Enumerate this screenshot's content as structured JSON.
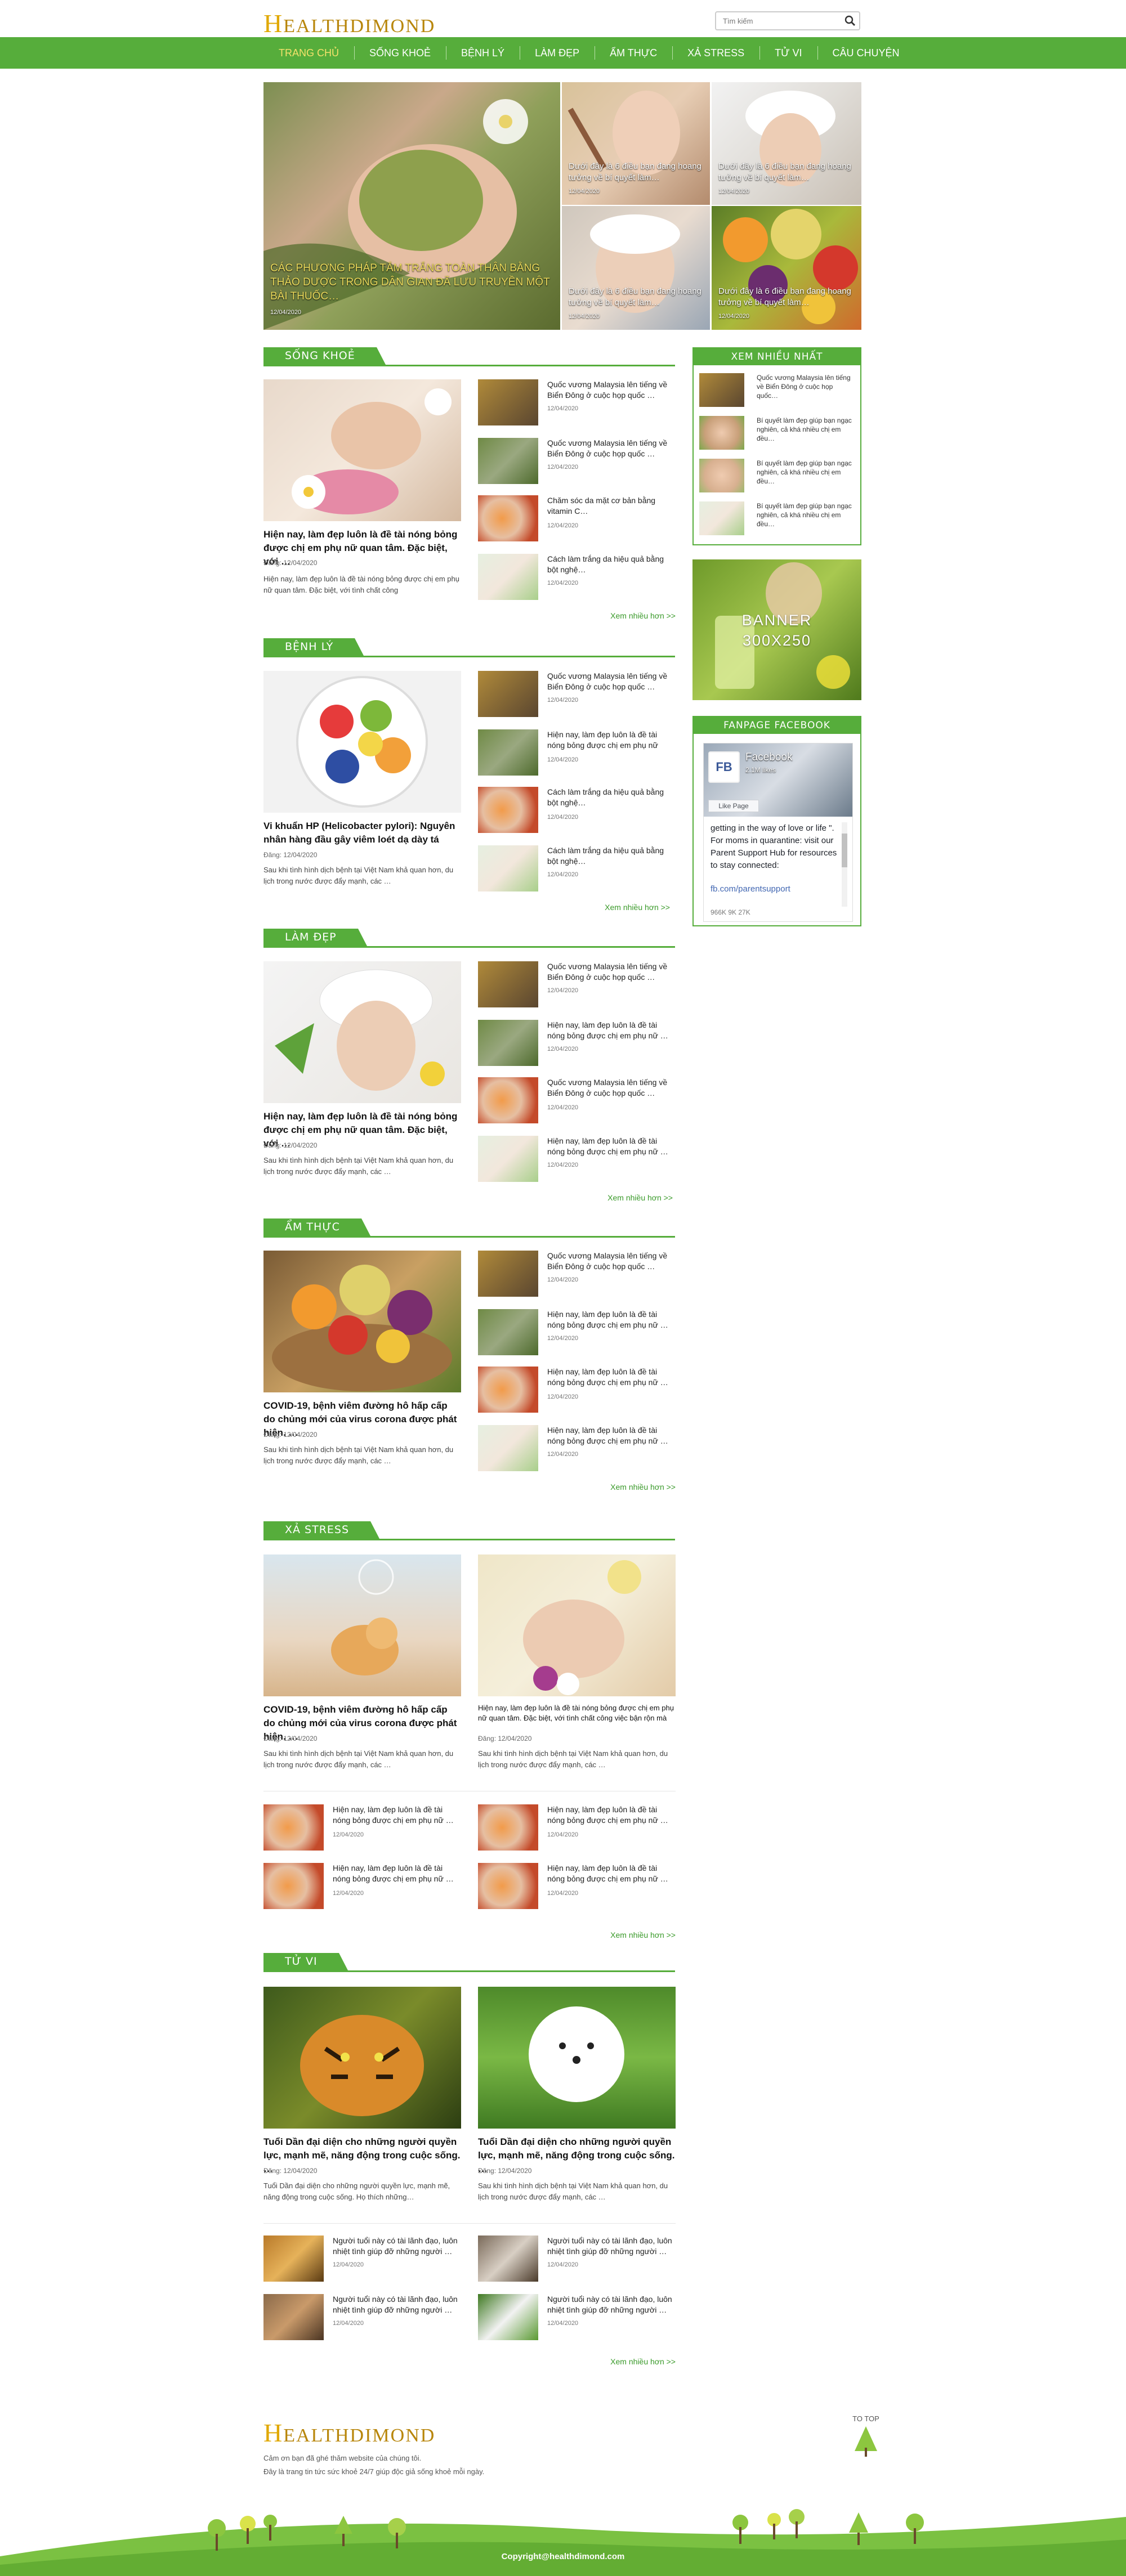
{
  "header": {
    "logo_initial": "H",
    "logo_rest": "EALTHDIMOND",
    "search_placeholder": "Tìm kiếm"
  },
  "nav": [
    "TRANG CHỦ",
    "SỐNG KHOẺ",
    "BỆNH LÝ",
    "LÀM ĐẸP",
    "ẨM THỰC",
    "XẢ STRESS",
    "TỬ VI",
    "CÂU CHUYỆN"
  ],
  "hero": {
    "main": {
      "title": "CÁC PHƯƠNG PHÁP TẮM TRẮNG TOÀN THÂN BẰNG THẢO DƯỢC TRONG DÂN GIAN ĐÃ LƯU TRUYỀN MỘT BÀI THUỐC…",
      "date": "12/04/2020"
    },
    "tiles": [
      {
        "title": "Dưới đây là 6 điều bạn đang hoang tưởng về bí quyết làm…",
        "date": "12/04/2020"
      },
      {
        "title": "Dưới đây là 6 điều bạn đang hoang tưởng về bí quyết làm…",
        "date": "12/04/2020"
      },
      {
        "title": "Dưới đây là 6 điều bạn đang hoang tưởng về bí quyết làm…",
        "date": "12/04/2020"
      },
      {
        "title": "Dưới đây là 6 điều bạn đang hoang tưởng về bí quyết làm…",
        "date": "12/04/2020"
      }
    ]
  },
  "sections": [
    {
      "title": "SỐNG KHOẺ",
      "big": {
        "title": "Hiện nay, làm đẹp luôn là đề tài nóng bỏng được chị em phụ nữ quan tâm. Đặc biệt, với …",
        "meta": "Đăng: 12/04/2020",
        "excerpt": "Hiện nay, làm đẹp luôn là đề tài nóng bỏng được chị em phụ nữ quan tâm. Đặc biệt, với tình chất công"
      },
      "list": [
        {
          "title": "Quốc vương Malaysia lên tiếng về Biển Đông ở cuộc họp quốc …",
          "date": "12/04/2020"
        },
        {
          "title": "Quốc vương Malaysia lên tiếng về Biển Đông ở cuộc họp quốc …",
          "date": "12/04/2020"
        },
        {
          "title": "Chăm sóc da mặt cơ bản bằng vitamin C…",
          "date": "12/04/2020"
        },
        {
          "title": "Cách làm trắng da hiệu quả bằng bột nghệ…",
          "date": "12/04/2020"
        }
      ],
      "more": "Xem nhiều hơn >>"
    },
    {
      "title": "BỆNH LÝ",
      "big": {
        "title": "Vi khuẩn HP (Helicobacter pylori): Nguyên nhân hàng đầu gây viêm loét dạ dày tá tràng ở",
        "meta": "Đăng: 12/04/2020",
        "excerpt": "Sau khi tình hình dịch bệnh tại Việt Nam khả quan hơn, du lịch trong nước được đẩy mạnh, các …"
      },
      "list": [
        {
          "title": "Quốc vương Malaysia lên tiếng về Biển Đông ở cuộc họp quốc …",
          "date": "12/04/2020"
        },
        {
          "title": "Hiện nay, làm đẹp luôn là đề tài nóng bỏng được chị em phụ nữ",
          "date": "12/04/2020"
        },
        {
          "title": "Cách làm trắng da hiệu quả bằng bột nghệ…",
          "date": "12/04/2020"
        },
        {
          "title": "Cách làm trắng da hiệu quả bằng bột nghệ…",
          "date": "12/04/2020"
        }
      ],
      "more": "Xem nhiều hơn >>"
    },
    {
      "title": "LÀM ĐẸP",
      "big": {
        "title": "Hiện nay, làm đẹp luôn là đề tài nóng bỏng được chị em phụ nữ quan tâm. Đặc biệt, với …",
        "meta": "Đăng: 12/04/2020",
        "excerpt": "Sau khi tình hình dịch bệnh tại Việt Nam khả quan hơn, du lịch trong nước được đẩy mạnh, các …"
      },
      "list": [
        {
          "title": "Quốc vương Malaysia lên tiếng về Biển Đông ở cuộc họp quốc …",
          "date": "12/04/2020"
        },
        {
          "title": "Hiện nay, làm đẹp luôn là đề tài nóng bỏng được chị em phụ nữ …",
          "date": "12/04/2020"
        },
        {
          "title": "Quốc vương Malaysia lên tiếng về Biển Đông ở cuộc họp quốc …",
          "date": "12/04/2020"
        },
        {
          "title": "Hiện nay, làm đẹp luôn là đề tài nóng bỏng được chị em phụ nữ …",
          "date": "12/04/2020"
        }
      ],
      "more": "Xem nhiều hơn >>"
    },
    {
      "title": "ẨM THỰC",
      "big": {
        "title": "COVID-19, bệnh viêm đường hô hấp cấp do chủng mới của virus corona được phát hiện. …",
        "meta": "Đăng: 12/04/2020",
        "excerpt": "Sau khi tình hình dịch bệnh tại Việt Nam khả quan hơn, du lịch trong nước được đẩy mạnh, các …"
      },
      "list": [
        {
          "title": "Quốc vương Malaysia lên tiếng về Biển Đông ở cuộc họp quốc …",
          "date": "12/04/2020"
        },
        {
          "title": "Hiện nay, làm đẹp luôn là đề tài nóng bỏng được chị em phụ nữ …",
          "date": "12/04/2020"
        },
        {
          "title": "Hiện nay, làm đẹp luôn là đề tài nóng bỏng được chị em phụ nữ …",
          "date": "12/04/2020"
        },
        {
          "title": "Hiện nay, làm đẹp luôn là đề tài nóng bỏng được chị em phụ nữ …",
          "date": "12/04/2020"
        }
      ],
      "more": "Xem nhiều hơn >>"
    }
  ],
  "stress": {
    "title": "XẢ STRESS",
    "left": {
      "title": "COVID-19, bệnh viêm đường hô hấp cấp do chủng mới của virus corona được phát hiện. …",
      "meta": "Đăng: 12/04/2020",
      "excerpt": "Sau khi tình hình dịch bệnh tại Việt Nam khả quan hơn, du lịch trong nước được đẩy mạnh, các …"
    },
    "right": {
      "title": "Hiện nay, làm đẹp luôn là đề tài nóng bỏng được chị em phụ nữ quan tâm. Đặc biệt, với tình chất công việc bận rộn mà …",
      "meta": "Đăng: 12/04/2020",
      "excerpt": "Sau khi tình hình dịch bệnh tại Việt Nam khả quan hơn, du lịch trong nước được đẩy mạnh, các …"
    },
    "list": [
      {
        "title": "Hiện nay, làm đẹp luôn là đề tài nóng bỏng được chị em phụ nữ …",
        "date": "12/04/2020"
      },
      {
        "title": "Hiện nay, làm đẹp luôn là đề tài nóng bỏng được chị em phụ nữ …",
        "date": "12/04/2020"
      },
      {
        "title": "Hiện nay, làm đẹp luôn là đề tài nóng bỏng được chị em phụ nữ …",
        "date": "12/04/2020"
      },
      {
        "title": "Hiện nay, làm đẹp luôn là đề tài nóng bỏng được chị em phụ nữ …",
        "date": "12/04/2020"
      }
    ],
    "more": "Xem nhiều hơn >>"
  },
  "tuvi": {
    "title": "TỬ VI",
    "left": {
      "title": "Tuổi Dần đại diện cho những người quyền lực, mạnh mẽ, năng động trong cuộc sống. …",
      "meta": "Đăng: 12/04/2020",
      "excerpt": "Tuổi Dần đại diện cho những người quyền lực, mạnh mẽ, năng động trong cuộc sống. Họ thích những…"
    },
    "right": {
      "title": "Tuổi Dần đại diện cho những người quyền lực, mạnh mẽ, năng động trong cuộc sống. …",
      "meta": "Đăng: 12/04/2020",
      "excerpt": "Sau khi tình hình dịch bệnh tại Việt Nam khả quan hơn, du lịch trong nước được đẩy mạnh, các …"
    },
    "list": [
      {
        "title": "Người tuổi này có tài lãnh đạo, luôn nhiệt tình giúp đỡ những người …",
        "date": "12/04/2020"
      },
      {
        "title": "Người tuổi này có tài lãnh đạo, luôn nhiệt tình giúp đỡ những người …",
        "date": "12/04/2020"
      },
      {
        "title": "Người tuổi này có tài lãnh đạo, luôn nhiệt tình giúp đỡ những người …",
        "date": "12/04/2020"
      },
      {
        "title": "Người tuổi này có tài lãnh đạo, luôn nhiệt tình giúp đỡ những người …",
        "date": "12/04/2020"
      }
    ],
    "more": "Xem nhiều hơn >>"
  },
  "sidebar": {
    "most_viewed_title": "XEM NHIỀU NHẤT",
    "most_viewed": [
      "Quốc vương Malaysia lên tiếng về Biển Đông ở cuộc họp quốc…",
      "Bí quyết làm đẹp giúp bạn ngạc nghiên, cả khá nhiều chị em đều…",
      "Bí quyết làm đẹp giúp bạn ngạc nghiên, cả khá nhiều chị em đều…",
      "Bí quyết làm đẹp giúp bạn ngạc nghiên, cả khá nhiều chị em đều…"
    ],
    "banner": "BANNER",
    "banner_size": "300X250",
    "fanpage_title": "FANPAGE FACEBOOK",
    "fb": {
      "badge": "FB",
      "name": "Facebook",
      "likes": "2.1M likes",
      "like_btn": "Like Page",
      "post": "getting in the way of love or life \". For moms in quarantine: visit our Parent Support Hub for resources to stay connected:",
      "link": "fb.com/parentsupport",
      "stats": "966K  9K  27K"
    }
  },
  "footer": {
    "logo_initial": "H",
    "logo_rest": "EALTHDIMOND",
    "line1": "Cảm ơn bạn đã ghé thăm website của chúng tôi.",
    "line2": "Đây là trang tin tức sức khoẻ 24/7 giúp độc giả sống khoẻ mỗi ngày.",
    "to_top": "TO TOP",
    "copyright": "Copyright@healthdimond.com"
  },
  "colors": {
    "green": "#56ad3b",
    "gold": "#e0a800",
    "link": "#3a9a2a"
  }
}
